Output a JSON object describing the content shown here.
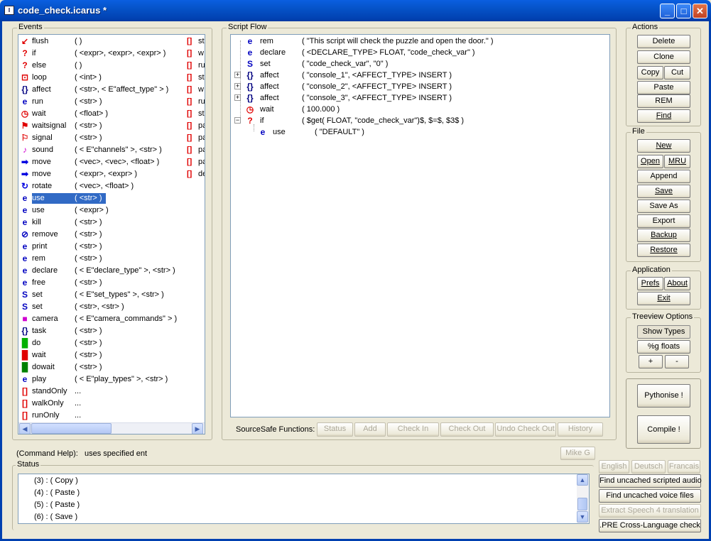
{
  "window": {
    "title": "code_check.icarus *"
  },
  "events": {
    "label": "Events",
    "items": [
      {
        "icon": "flush-icon",
        "glyph": "↙",
        "color": "#e00000",
        "name": "flush",
        "args": "(   )",
        "side": "st"
      },
      {
        "icon": "if-icon",
        "glyph": "?",
        "color": "#e00000",
        "name": "if",
        "args": "( <expr>, <expr>, <expr> )",
        "side": "w"
      },
      {
        "icon": "else-icon",
        "glyph": "?",
        "color": "#e00000",
        "name": "else",
        "args": "(   )",
        "side": "ru"
      },
      {
        "icon": "loop-icon",
        "glyph": "⊡",
        "color": "#e00000",
        "name": "loop",
        "args": "( <int> )",
        "side": "st"
      },
      {
        "icon": "affect-icon",
        "glyph": "{}",
        "color": "#000080",
        "name": "affect",
        "args": "( <str>, < E\"affect_type\" > )",
        "side": "w"
      },
      {
        "icon": "run-icon",
        "glyph": "e",
        "color": "#0000c0",
        "name": "run",
        "args": "( <str> )",
        "side": "ru"
      },
      {
        "icon": "wait-icon",
        "glyph": "◷",
        "color": "#e00000",
        "name": "wait",
        "args": "( <float> )",
        "side": "st"
      },
      {
        "icon": "waitsignal-icon",
        "glyph": "⚑",
        "color": "#e00000",
        "name": "waitsignal",
        "args": "( <str> )",
        "side": "pa"
      },
      {
        "icon": "signal-icon",
        "glyph": "⚐",
        "color": "#e00000",
        "name": "signal",
        "args": "( <str> )",
        "side": "pa"
      },
      {
        "icon": "sound-icon",
        "glyph": "♪",
        "color": "#d000d0",
        "name": "sound",
        "args": "( < E\"channels\" >, <str> )",
        "side": "pa"
      },
      {
        "icon": "move-icon",
        "glyph": "➡",
        "color": "#0000e0",
        "name": "move",
        "args": "( <vec>, <vec>, <float> )",
        "side": "pa"
      },
      {
        "icon": "move-icon",
        "glyph": "➡",
        "color": "#0000e0",
        "name": "move",
        "args": "( <expr>, <expr> )",
        "side": "de"
      },
      {
        "icon": "rotate-icon",
        "glyph": "↻",
        "color": "#0000e0",
        "name": "rotate",
        "args": "( <vec>, <float> )",
        "side": ""
      },
      {
        "icon": "use-icon",
        "glyph": "e",
        "color": "#0000c0",
        "name": "use",
        "args": "( <str> )",
        "side": "",
        "selected": true
      },
      {
        "icon": "use-icon",
        "glyph": "e",
        "color": "#0000c0",
        "name": "use",
        "args": "( <expr> )",
        "side": ""
      },
      {
        "icon": "kill-icon",
        "glyph": "e",
        "color": "#0000c0",
        "name": "kill",
        "args": "( <str> )",
        "side": ""
      },
      {
        "icon": "remove-icon",
        "glyph": "⊘",
        "color": "#0000c0",
        "name": "remove",
        "args": "( <str> )",
        "side": ""
      },
      {
        "icon": "print-icon",
        "glyph": "e",
        "color": "#0000c0",
        "name": "print",
        "args": "( <str> )",
        "side": ""
      },
      {
        "icon": "rem-icon",
        "glyph": "e",
        "color": "#0000c0",
        "name": "rem",
        "args": "( <str> )",
        "side": ""
      },
      {
        "icon": "declare-icon",
        "glyph": "e",
        "color": "#0000c0",
        "name": "declare",
        "args": "( < E\"declare_type\" >, <str> )",
        "side": ""
      },
      {
        "icon": "free-icon",
        "glyph": "e",
        "color": "#0000c0",
        "name": "free",
        "args": "( <str> )",
        "side": ""
      },
      {
        "icon": "set-icon",
        "glyph": "S",
        "color": "#0000c0",
        "name": "set",
        "args": "( < E\"set_types\" >, <str> )",
        "side": ""
      },
      {
        "icon": "set-icon",
        "glyph": "S",
        "color": "#0000c0",
        "name": "set",
        "args": "( <str>, <str> )",
        "side": ""
      },
      {
        "icon": "camera-icon",
        "glyph": "■",
        "color": "#d000d0",
        "name": "camera",
        "args": "( < E\"camera_commands\" > )",
        "side": ""
      },
      {
        "icon": "task-icon",
        "glyph": "{}",
        "color": "#000080",
        "name": "task",
        "args": "( <str> )",
        "side": ""
      },
      {
        "icon": "do-icon",
        "glyph": "█",
        "color": "#00b000",
        "name": "do",
        "args": "( <str> )",
        "side": ""
      },
      {
        "icon": "wait-red-icon",
        "glyph": "█",
        "color": "#e00000",
        "name": "wait",
        "args": "( <str> )",
        "side": ""
      },
      {
        "icon": "dowait-icon",
        "glyph": "█",
        "color": "#008000",
        "name": "dowait",
        "args": "( <str> )",
        "side": ""
      },
      {
        "icon": "play-icon",
        "glyph": "e",
        "color": "#0000c0",
        "name": "play",
        "args": "( < E\"play_types\" >, <str> )",
        "side": ""
      },
      {
        "icon": "standonly-icon",
        "glyph": "[]",
        "color": "#e00000",
        "name": "standOnly",
        "args": "...",
        "side": ""
      },
      {
        "icon": "walkonly-icon",
        "glyph": "[]",
        "color": "#e00000",
        "name": "walkOnly",
        "args": "...",
        "side": ""
      },
      {
        "icon": "runonly-icon",
        "glyph": "[]",
        "color": "#e00000",
        "name": "runOnly",
        "args": "...",
        "side": ""
      }
    ]
  },
  "script": {
    "label": "Script Flow",
    "rows": [
      {
        "icon": "rem-icon",
        "glyph": "e",
        "color": "#0000c0",
        "name": "rem",
        "args": "( \"This script will check the puzzle and open the door.\" )",
        "indent": 0,
        "exp": ""
      },
      {
        "icon": "declare-icon",
        "glyph": "e",
        "color": "#0000c0",
        "name": "declare",
        "args": "( <DECLARE_TYPE> FLOAT, \"code_check_var\" )",
        "indent": 0,
        "exp": ""
      },
      {
        "icon": "set-icon",
        "glyph": "S",
        "color": "#0000c0",
        "name": "set",
        "args": "( \"code_check_var\", \"0\" )",
        "indent": 0,
        "exp": ""
      },
      {
        "icon": "affect-icon",
        "glyph": "{}",
        "color": "#000080",
        "name": "affect",
        "args": "( \"console_1\", <AFFECT_TYPE> INSERT )",
        "indent": 0,
        "exp": "+"
      },
      {
        "icon": "affect-icon",
        "glyph": "{}",
        "color": "#000080",
        "name": "affect",
        "args": "( \"console_2\", <AFFECT_TYPE> INSERT )",
        "indent": 0,
        "exp": "+"
      },
      {
        "icon": "affect-icon",
        "glyph": "{}",
        "color": "#000080",
        "name": "affect",
        "args": "( \"console_3\", <AFFECT_TYPE> INSERT )",
        "indent": 0,
        "exp": "+"
      },
      {
        "icon": "wait-icon",
        "glyph": "◷",
        "color": "#e00000",
        "name": "wait",
        "args": "( 100.000 )",
        "indent": 0,
        "exp": ""
      },
      {
        "icon": "if-icon",
        "glyph": "?",
        "color": "#e00000",
        "name": "if",
        "args": "( $get( FLOAT, \"code_check_var\")$, $=$, $3$ )",
        "indent": 0,
        "exp": "−"
      },
      {
        "icon": "use-icon",
        "glyph": "e",
        "color": "#0000c0",
        "name": "use",
        "args": "( \"DEFAULT\" )",
        "indent": 1,
        "exp": ""
      }
    ]
  },
  "sourcesafe": {
    "label": "SourceSafe Functions:",
    "buttons": [
      "Status",
      "Add",
      "Check In",
      "Check Out",
      "Undo Check Out",
      "History"
    ]
  },
  "actions": {
    "label": "Actions",
    "delete": "Delete",
    "clone": "Clone",
    "copy": "Copy",
    "cut": "Cut",
    "paste": "Paste",
    "rem": "REM",
    "find": "Find"
  },
  "file": {
    "label": "File",
    "new": "New",
    "open": "Open",
    "mru": "MRU",
    "append": "Append",
    "save": "Save",
    "save_as": "Save As",
    "export": "Export",
    "backup": "Backup",
    "restore": "Restore"
  },
  "application": {
    "label": "Application",
    "prefs": "Prefs",
    "about": "About",
    "exit": "Exit"
  },
  "treeview": {
    "label": "Treeview Options",
    "show_types": "Show Types",
    "g_floats": "%g floats",
    "plus": "+",
    "minus": "-"
  },
  "pythonise": "Pythonise !",
  "compile": "Compile !",
  "command_help": {
    "label": "(Command Help):",
    "text": "uses specified ent"
  },
  "user_button": "Mike G",
  "status": {
    "label": "Status",
    "lines": [
      "(3) : ( Copy )",
      "(4) : ( Paste )",
      "(5) : ( Paste )",
      "(6) : ( Save )"
    ]
  },
  "languages": {
    "english": "English",
    "deutsch": "Deutsch",
    "francais": "Francais"
  },
  "tools": {
    "find_audio": "Find uncached scripted audio",
    "find_voice": "Find uncached voice files",
    "extract_speech": "Extract Speech 4 translation",
    "pre_check": ".PRE Cross-Language check"
  }
}
